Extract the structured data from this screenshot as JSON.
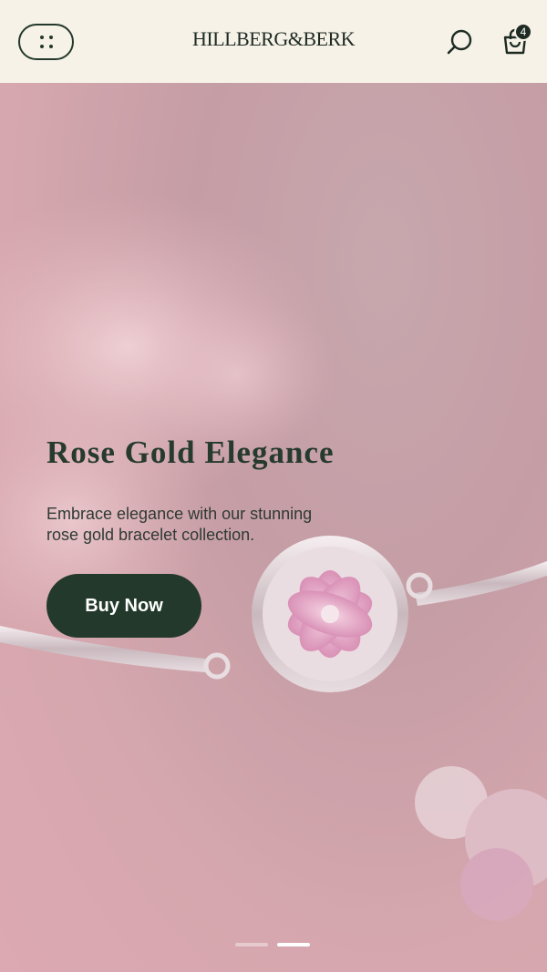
{
  "header": {
    "brand": "HILLBERG&BERK",
    "cart_count": "4"
  },
  "hero": {
    "title": "Rose Gold Elegance",
    "description": "Embrace elegance with our stunning rose gold bracelet collection.",
    "cta_label": "Buy Now",
    "slides_total": 2,
    "active_slide": 2
  },
  "icons": {
    "menu": "menu-dots-icon",
    "search": "search-icon",
    "cart": "shopping-bag-icon"
  },
  "colors": {
    "header_bg": "#f6f2e8",
    "brand_green": "#23392b",
    "hero_pink": "#d6a7ae"
  }
}
